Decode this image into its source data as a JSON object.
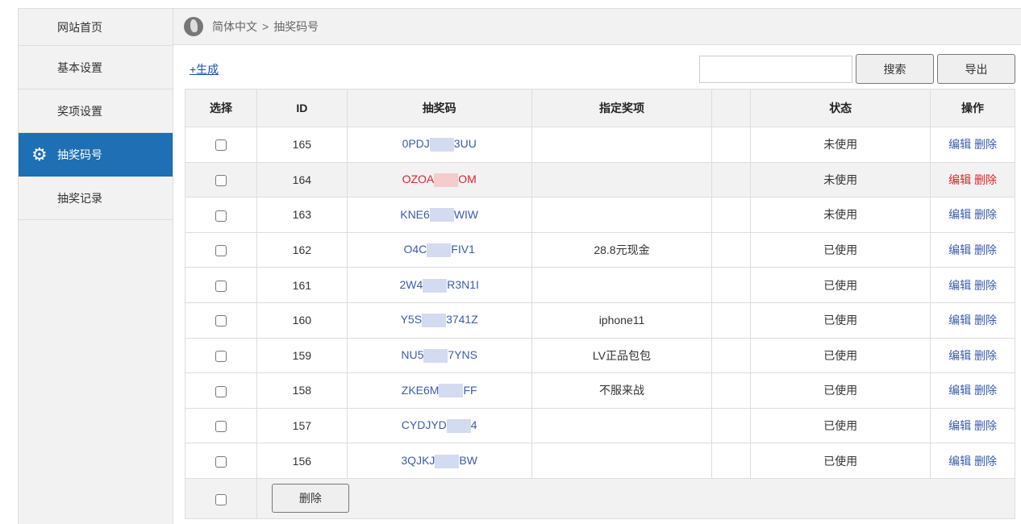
{
  "sidebar": {
    "items": [
      {
        "label": "网站首页"
      },
      {
        "label": "基本设置"
      },
      {
        "label": "奖项设置"
      },
      {
        "label": "抽奖码号",
        "active": true
      },
      {
        "label": "抽奖记录"
      }
    ]
  },
  "breadcrumb": {
    "lang": "简体中文",
    "sep": ">",
    "current": "抽奖码号"
  },
  "toolbar": {
    "generate": "+生成",
    "search_value": "",
    "search": "搜索",
    "export": "导出"
  },
  "table": {
    "headers": [
      "选择",
      "ID",
      "抽奖码",
      "指定奖项",
      "",
      "状态",
      "操作"
    ],
    "rows": [
      {
        "id": "165",
        "code_start": "0PDJ",
        "code_end": "3UU",
        "prize": "",
        "status": "未使用"
      },
      {
        "id": "164",
        "code_start": "OZOA",
        "code_end": "OM",
        "prize": "",
        "status": "未使用",
        "highlight": true
      },
      {
        "id": "163",
        "code_start": "KNE6",
        "code_end": "WIW",
        "prize": "",
        "status": "未使用"
      },
      {
        "id": "162",
        "code_start": "O4C",
        "code_end": "FIV1",
        "prize": "28.8元现金",
        "status": "已使用"
      },
      {
        "id": "161",
        "code_start": "2W4",
        "code_end": "R3N1I",
        "prize": "",
        "status": "已使用"
      },
      {
        "id": "160",
        "code_start": "Y5S",
        "code_end": "3741Z",
        "prize": "iphone11",
        "status": "已使用"
      },
      {
        "id": "159",
        "code_start": "NU5",
        "code_end": "7YNS",
        "prize": "LV正品包包",
        "status": "已使用"
      },
      {
        "id": "158",
        "code_start": "ZKE6M",
        "code_end": "FF",
        "prize": "不服来战",
        "status": "已使用"
      },
      {
        "id": "157",
        "code_start": "CYDJYD",
        "code_end": "4",
        "prize": "",
        "status": "已使用"
      },
      {
        "id": "156",
        "code_start": "3QJKJ",
        "code_end": "BW",
        "prize": "",
        "status": "已使用"
      }
    ],
    "edit": "编辑",
    "delete": "删除",
    "bulk_delete": "删除"
  }
}
